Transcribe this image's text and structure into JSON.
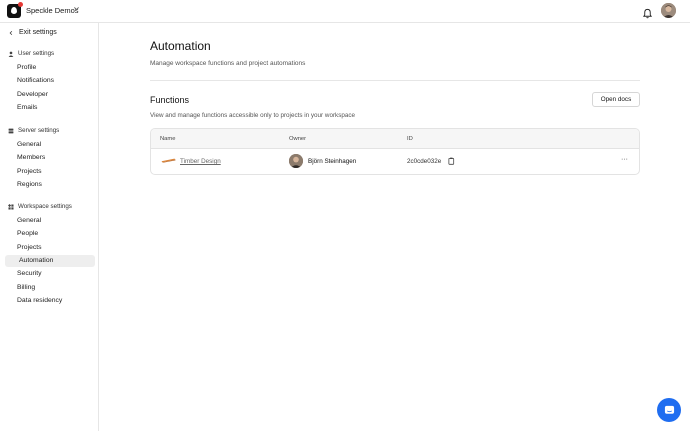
{
  "topbar": {
    "workspace_name": "Speckle Demos",
    "icons": [
      "speckle-logo-icon",
      "chevron-down-icon",
      "bell-icon",
      "avatar"
    ]
  },
  "sidebar": {
    "exit_label": "Exit settings",
    "sections": [
      {
        "title": "User settings",
        "icon": "user-icon",
        "items": [
          "Profile",
          "Notifications",
          "Developer",
          "Emails"
        ]
      },
      {
        "title": "Server settings",
        "icon": "server-icon",
        "items": [
          "General",
          "Members",
          "Projects",
          "Regions"
        ]
      },
      {
        "title": "Workspace settings",
        "icon": "workspace-icon",
        "items": [
          "General",
          "People",
          "Projects",
          "Automation",
          "Security",
          "Billing",
          "Data residency"
        ]
      }
    ],
    "active_item": "Automation"
  },
  "main": {
    "title": "Automation",
    "description": "Manage workspace functions and project automations",
    "functions": {
      "heading": "Functions",
      "description": "View and manage functions accessible only to projects in your workspace",
      "open_docs_label": "Open docs",
      "columns": [
        "Name",
        "Owner",
        "ID"
      ],
      "rows": [
        {
          "name": "Timber Design",
          "owner": "Björn Steinhagen",
          "id": "2c0cde032e",
          "more": "···"
        }
      ]
    }
  },
  "colors": {
    "accent": "#1f6df0",
    "active_bg": "#eeeeee",
    "border": "#e6e6e6"
  }
}
